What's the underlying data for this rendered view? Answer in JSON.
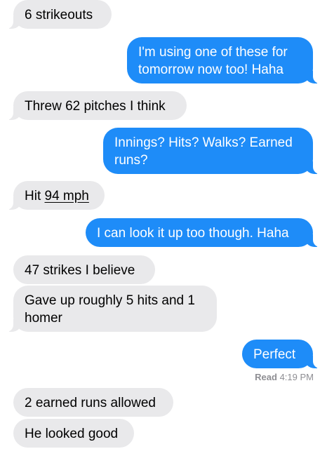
{
  "messages": {
    "m1": "6 strikeouts",
    "m2": "I'm using one of these for tomorrow now too! Haha",
    "m3": "Threw 62 pitches I think",
    "m4": "Innings? Hits? Walks? Earned runs?",
    "m5_prefix": "Hit ",
    "m5_link": "94 mph",
    "m6": "I can look it up too though. Haha",
    "m7": "47 strikes I believe",
    "m8": "Gave up roughly 5 hits and 1 homer",
    "m9": "Perfect",
    "m10": "2 earned runs allowed",
    "m11": "He looked good"
  },
  "receipt": {
    "status": "Read",
    "time": "4:19 PM"
  },
  "colors": {
    "incoming_bubble": "#e9e9eb",
    "outgoing_bubble": "#1e8cf8",
    "receipt_text": "#8e8e93"
  }
}
